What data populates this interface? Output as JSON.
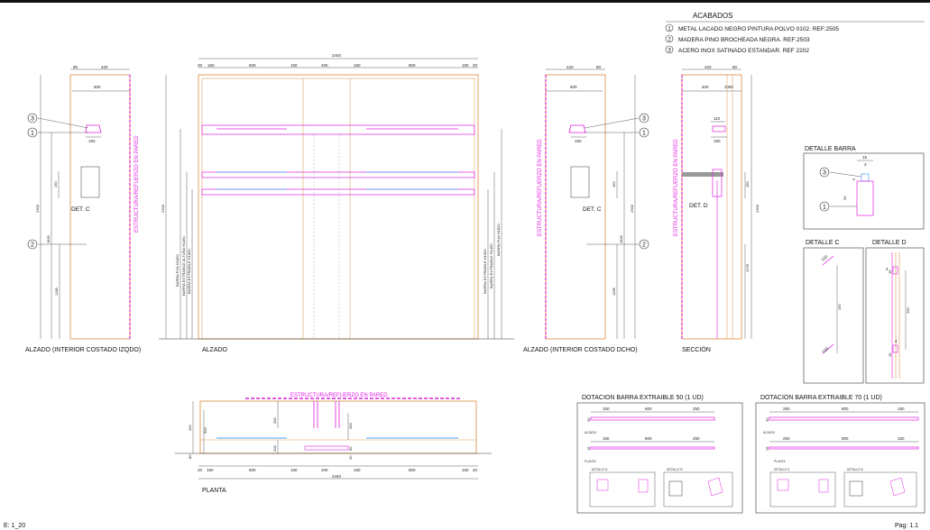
{
  "finishes": {
    "title": "ACABADOS",
    "items": [
      {
        "num": "1",
        "text": "METAL LACADO NEGRO PINTURA POLVO 0102. REF:2505"
      },
      {
        "num": "2",
        "text": "MADERA PINO BROCHEADA NEGRA. REF:2503"
      },
      {
        "num": "3",
        "text": "ACERO INOX SATINADO ESTANDAR. REF 2202"
      }
    ]
  },
  "views": {
    "left_elevation": "ALZADO (INTERIOR COSTADO IZQDO)",
    "front_elevation": "ALZADO",
    "right_elevation": "ALZADO (INTERIOR COSTADO DCHO)",
    "section": "SECCIÓN",
    "plan": "PLANTA"
  },
  "annotations": {
    "wall_structure_top": "ESTRUCTURA/REFUERZO EN PARED",
    "wall_structure_side": "ESTRUCTURA/REFUERZO EN PARED",
    "det_c": "DET. C",
    "det_d": "DET. D",
    "barra_fija": "BARRA FIJA H1820",
    "barra_ext_alta": "BARRA EXTRAIBLE ALTURA H1450",
    "barra_ext": "BARRA EXTRAIBLE H1050",
    "barra_ext_r1": "BARRA EXTRAIBLE H1050",
    "barra_ext_r2": "BARRA EXTRAIBLE H1450",
    "barra_fija_r": "BARRA FIJA H1820"
  },
  "dimensions": {
    "total_width": "2440",
    "front_top": [
      "20",
      "150",
      "600",
      "150",
      "400",
      "150",
      "800",
      "150",
      "20"
    ],
    "front_bottom": [
      "20",
      "150",
      "600",
      "150",
      "400",
      "150",
      "800",
      "150",
      "20"
    ],
    "height": "2300",
    "left_top": [
      "80",
      "420"
    ],
    "left_500": "500",
    "left_150": "150",
    "left_150v": "150",
    "left_1835": "1835",
    "left_1285": "1285",
    "right_top": [
      "420",
      "80"
    ],
    "right_500": "500",
    "sec_top": [
      "420",
      "80"
    ],
    "sec_400": "400",
    "sec_2080": "2080",
    "sec_110": "110",
    "sec_150": "150",
    "sec_1278": "1278",
    "plan_420": "420",
    "plan_300": "300",
    "plan_500": "500",
    "plan_200": "200",
    "plan_400": "400",
    "plan_80": "80",
    "plan_20": "20",
    "plan_total": "2440"
  },
  "details": {
    "barra": "DETALLE BARRA",
    "c": "DETALLE C",
    "d": "DETALLE D",
    "barra_15": "15",
    "barra_3": "3",
    "barra_30": "30",
    "barra_5": "5",
    "c_150": "150",
    "c_120a": "120",
    "c_120b": "120",
    "d_150": "150",
    "d_4a": "4",
    "d_4b": "4",
    "d_16a": "16",
    "d_16b": "16"
  },
  "dotacion": {
    "d50": {
      "title": "DOTACION BARRA EXTRAIBLE 50 (1 UD)",
      "alzado": "ALZADO",
      "planta": "PLANTA",
      "det_a": "DETALLE A",
      "det_b": "DETALLE B",
      "dims": [
        "150",
        "600",
        "250"
      ],
      "h1": "30",
      "h2": "15"
    },
    "d70": {
      "title": "DOTACION BARRA EXTRAIBLE 70 (1 UD)",
      "alzado": "ALZADO",
      "planta": "PLANTA",
      "det_a": "DETALLE A",
      "det_b": "DETALLE B",
      "dims": [
        "250",
        "800",
        "150"
      ],
      "h1": "30",
      "h2": "15"
    }
  },
  "footer": {
    "scale": "E: 1_20",
    "page": "Pag: 1.1"
  }
}
